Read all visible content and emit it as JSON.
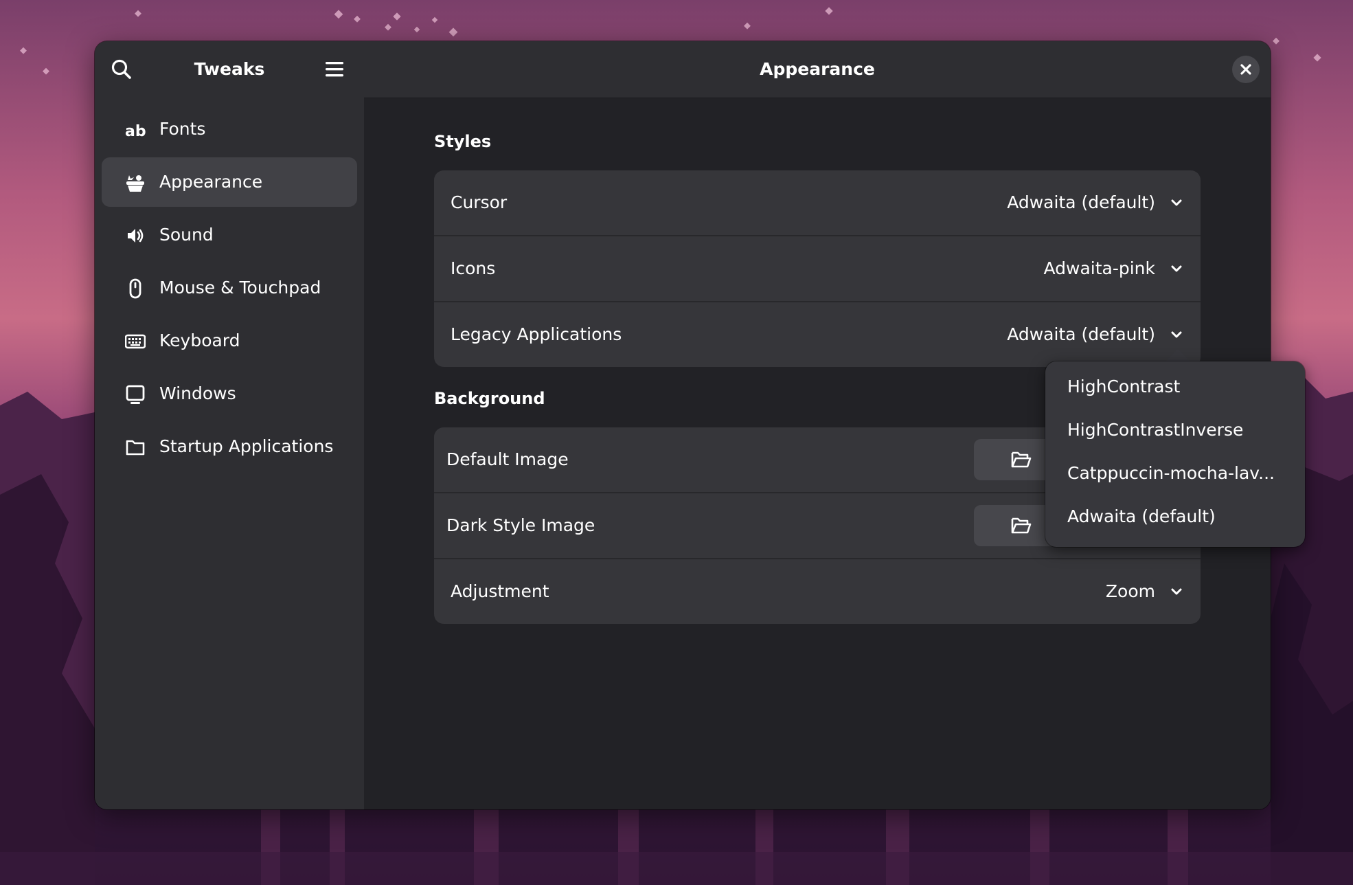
{
  "sidebar": {
    "title": "Tweaks",
    "search_icon": "search-icon",
    "menu_icon": "hamburger-menu-icon",
    "items": [
      {
        "label": "Fonts",
        "icon": "font-ab-icon"
      },
      {
        "label": "Appearance",
        "icon": "appearance-icon",
        "active": true
      },
      {
        "label": "Sound",
        "icon": "speaker-icon"
      },
      {
        "label": "Mouse & Touchpad",
        "icon": "mouse-icon"
      },
      {
        "label": "Keyboard",
        "icon": "keyboard-icon"
      },
      {
        "label": "Windows",
        "icon": "window-icon"
      },
      {
        "label": "Startup Applications",
        "icon": "folder-icon"
      }
    ]
  },
  "main": {
    "title": "Appearance",
    "close_icon": "close-icon",
    "styles": {
      "heading": "Styles",
      "rows": [
        {
          "label": "Cursor",
          "value": "Adwaita (default)"
        },
        {
          "label": "Icons",
          "value": "Adwaita-pink"
        },
        {
          "label": "Legacy Applications",
          "value": "Adwaita (default)"
        }
      ]
    },
    "background": {
      "heading": "Background",
      "rows": [
        {
          "label": "Default Image",
          "button_icon": "folder-open-icon"
        },
        {
          "label": "Dark Style Image",
          "button_icon": "folder-open-icon"
        },
        {
          "label": "Adjustment",
          "value": "Zoom"
        }
      ]
    }
  },
  "popover": {
    "options": [
      "HighContrast",
      "HighContrastInverse",
      "Catppuccin-mocha-lav...",
      "Adwaita (default)"
    ]
  },
  "colors": {
    "window_bg": "#222226",
    "sidebar_bg": "#2e2e32",
    "card_bg": "#36363a",
    "active_item_bg": "#414146"
  }
}
